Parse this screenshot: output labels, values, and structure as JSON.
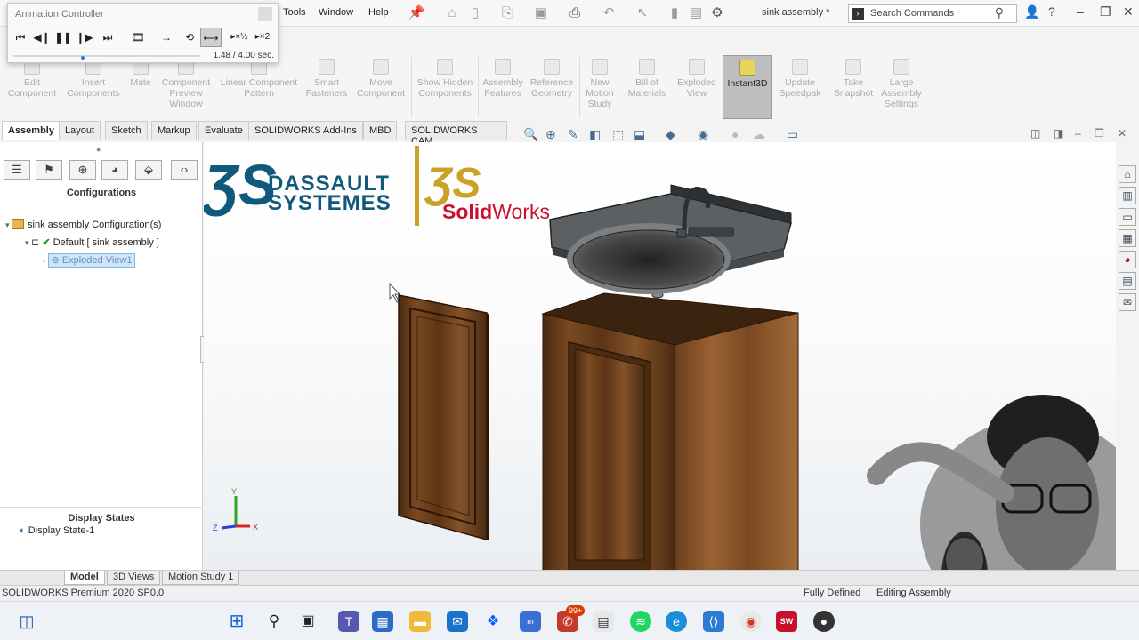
{
  "menubar": {
    "items": [
      "Tools",
      "Window",
      "Help"
    ],
    "document_title": "sink assembly *",
    "search_placeholder": "Search Commands"
  },
  "animation_controller": {
    "title": "Animation Controller",
    "time_display": "1.48 / 4.00 sec.",
    "progress": 0.37
  },
  "ribbon": {
    "buttons": [
      "Edit Component",
      "Insert Components",
      "Mate",
      "Component Preview Window",
      "Linear Component Pattern",
      "Smart Fasteners",
      "Move Component",
      "Show Hidden Components",
      "Assembly Features",
      "Reference Geometry",
      "New Motion Study",
      "Bill of Materials",
      "Exploded View",
      "Instant3D",
      "Update Speedpak",
      "Take Snapshot",
      "Large Assembly Settings"
    ]
  },
  "command_tabs": [
    "Assembly",
    "Layout",
    "Sketch",
    "Markup",
    "Evaluate",
    "SOLIDWORKS Add-Ins",
    "MBD",
    "SOLIDWORKS CAM"
  ],
  "left_panel": {
    "heading": "Configurations",
    "tree": {
      "root": "sink assembly Configuration(s)",
      "default": "Default [ sink assembly ]",
      "exploded": "Exploded View1"
    },
    "display_states_heading": "Display States",
    "display_state": "Display State-1"
  },
  "logo": {
    "brand_line1": "DASSAULT",
    "brand_line2": "SYSTEMES",
    "product_solid": "Solid",
    "product_works": "Works"
  },
  "triad": {
    "x": "X",
    "y": "Y",
    "z": "Z"
  },
  "bottom_tabs": [
    "Model",
    "3D Views",
    "Motion Study 1"
  ],
  "status": {
    "product": "SOLIDWORKS Premium 2020 SP0.0",
    "defined": "Fully Defined",
    "editing": "Editing Assembly"
  },
  "taskbar": {
    "badge": "99+"
  },
  "colors": {
    "accent": "#0f5a7a",
    "solidworks_red": "#c8102e",
    "brand_gold": "#c9a227",
    "wood": "#6b3e1d"
  }
}
